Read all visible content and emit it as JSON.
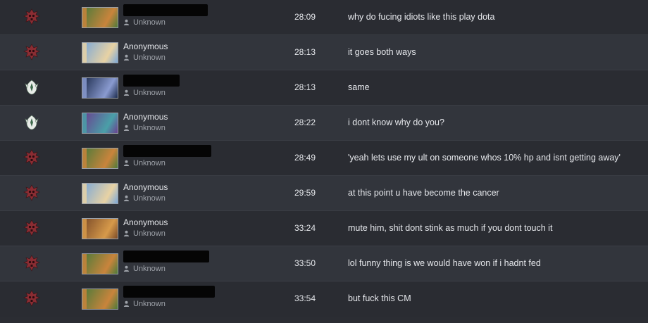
{
  "messages": [
    {
      "team": "dire",
      "hero_colors": [
        "#4c7a3a",
        "#c9843c"
      ],
      "name": "",
      "name_redacted": true,
      "redact_width": 120,
      "account": "Unknown",
      "time": "28:09",
      "text": "why do fucing idiots like this play dota"
    },
    {
      "team": "dire",
      "hero_colors": [
        "#7aa7d8",
        "#e8d2a4"
      ],
      "name": "Anonymous",
      "name_redacted": false,
      "redact_width": 0,
      "account": "Unknown",
      "time": "28:13",
      "text": "it goes both ways"
    },
    {
      "team": "radiant",
      "hero_colors": [
        "#1d2c4d",
        "#8a9bd0"
      ],
      "name": "",
      "name_redacted": true,
      "redact_width": 80,
      "account": "Unknown",
      "time": "28:13",
      "text": "same"
    },
    {
      "team": "radiant",
      "hero_colors": [
        "#6a3f8f",
        "#4aa0a8"
      ],
      "name": "Anonymous",
      "name_redacted": false,
      "redact_width": 0,
      "account": "Unknown",
      "time": "28:22",
      "text": "i dont know why do you?"
    },
    {
      "team": "dire",
      "hero_colors": [
        "#4c7a3a",
        "#c9843c"
      ],
      "name": "",
      "name_redacted": true,
      "redact_width": 125,
      "account": "Unknown",
      "time": "28:49",
      "text": "'yeah lets use my ult on someone whos 10% hp and isnt getting away'"
    },
    {
      "team": "dire",
      "hero_colors": [
        "#7aa7d8",
        "#e8d2a4"
      ],
      "name": "Anonymous",
      "name_redacted": false,
      "redact_width": 0,
      "account": "Unknown",
      "time": "29:59",
      "text": "at this point u have become the cancer"
    },
    {
      "team": "dire",
      "hero_colors": [
        "#7a4a28",
        "#d79a4a"
      ],
      "name": "Anonymous",
      "name_redacted": false,
      "redact_width": 0,
      "account": "Unknown",
      "time": "33:24",
      "text": "mute him, shit dont stink as much if you dont touch it"
    },
    {
      "team": "dire",
      "hero_colors": [
        "#4c7a3a",
        "#c9843c"
      ],
      "name": "",
      "name_redacted": true,
      "redact_width": 122,
      "account": "Unknown",
      "time": "33:50",
      "text": "lol funny thing is we would have won if i hadnt fed"
    },
    {
      "team": "dire",
      "hero_colors": [
        "#4c7a3a",
        "#c9843c"
      ],
      "name": "",
      "name_redacted": true,
      "redact_width": 130,
      "account": "Unknown",
      "time": "33:54",
      "text": "but fuck this CM"
    }
  ]
}
